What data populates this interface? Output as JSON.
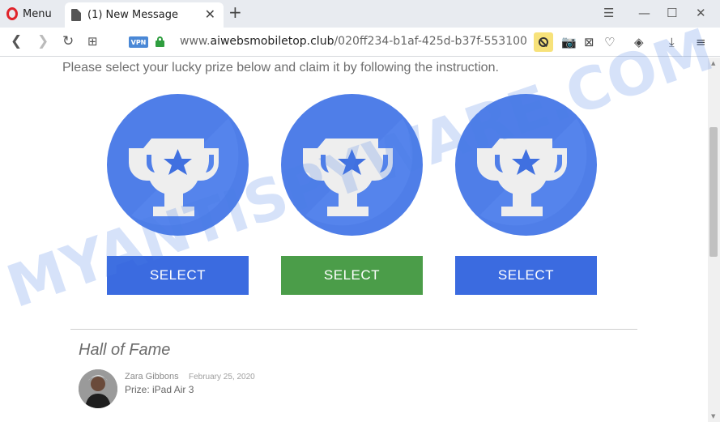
{
  "browser": {
    "menu_label": "Menu",
    "tab_title": "(1) New Message",
    "vpn_badge": "VPN",
    "url_prefix": "www.",
    "url_host": "aiwebsmobiletop.club",
    "url_path": "/020ff234-b1af-425d-b37f-553100"
  },
  "page": {
    "instruction": "Please select your lucky prize below and claim it by following the instruction.",
    "prizes": [
      {
        "icon": "trophy-icon",
        "button_label": "SELECT",
        "button_color": "#3b6be0"
      },
      {
        "icon": "trophy-icon",
        "button_label": "SELECT",
        "button_color": "#4b9d49"
      },
      {
        "icon": "trophy-icon",
        "button_label": "SELECT",
        "button_color": "#3b6be0"
      }
    ],
    "hall_of_fame": {
      "title": "Hall of Fame",
      "winners": [
        {
          "name": "Zara Gibbons",
          "date": "February 25, 2020",
          "prize": "Prize: iPad Air 3"
        }
      ]
    }
  },
  "watermark": "MYANTISPYWARE.COM",
  "colors": {
    "circle_blue": "#4f7ee8",
    "trophy_white": "#eeeeee",
    "star_blue": "#4070e0",
    "watermark_blue": "#4a7fe6"
  }
}
